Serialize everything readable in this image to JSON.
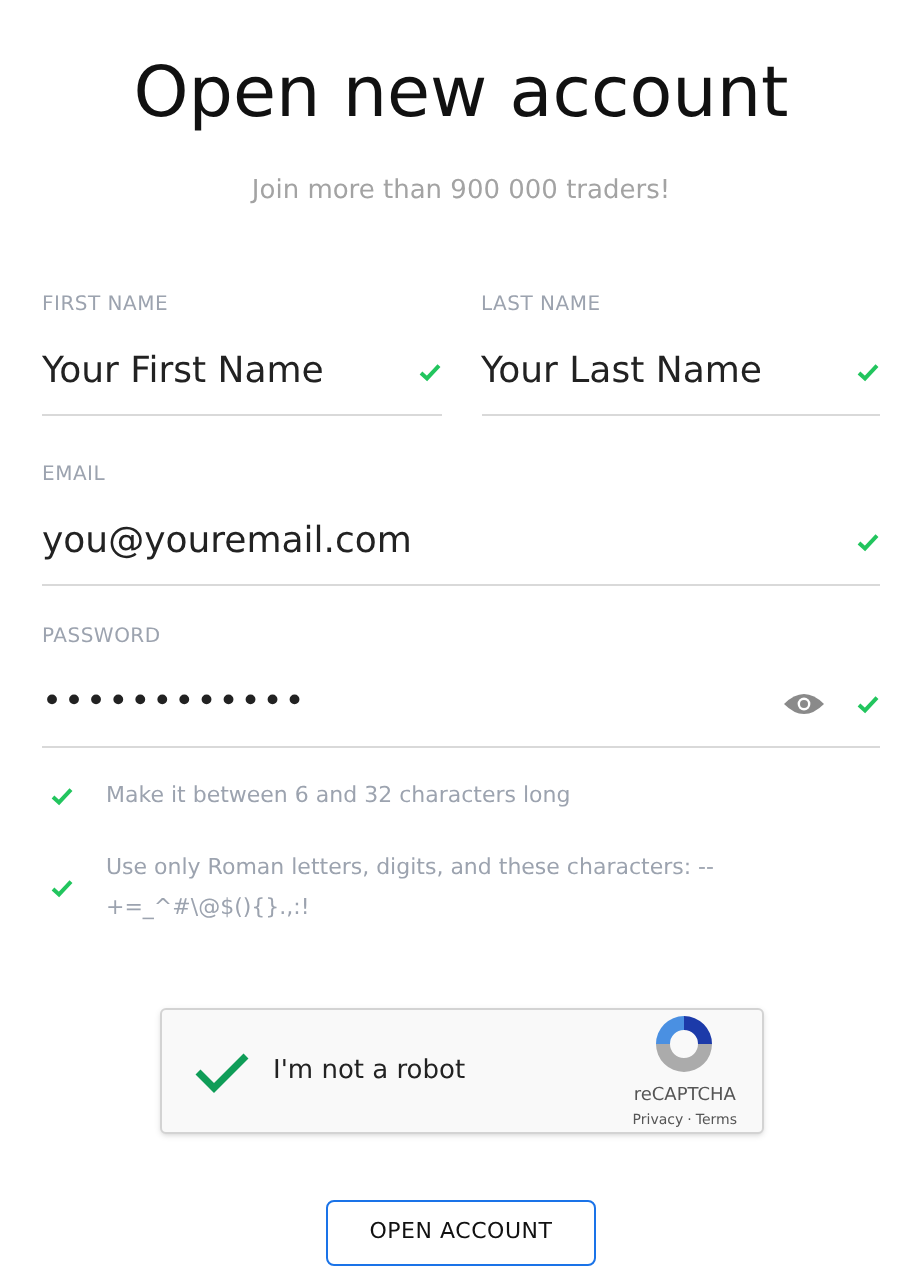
{
  "title": "Open new account",
  "subtitle": "Join more than 900 000 traders!",
  "name_fields": [
    {
      "label": "FIRST NAME",
      "value": "Your First Name",
      "valid": true
    },
    {
      "label": "LAST NAME",
      "value": "Your Last Name",
      "valid": true
    }
  ],
  "fields": [
    {
      "kind": "text",
      "label": "EMAIL",
      "value": "you@youremail.com",
      "valid": true
    },
    {
      "kind": "password",
      "label": "PASSWORD",
      "value": "••••••••••••",
      "valid": true
    }
  ],
  "password_rules": [
    {
      "text": "Make it between 6 and 32 characters long",
      "met": true
    },
    {
      "text": "Use only Roman letters, digits, and these characters: --+=_^#\\@$(){}.,:!",
      "met": true
    }
  ],
  "captcha": {
    "checked": true,
    "label": "I'm not a robot",
    "brand": "reCAPTCHA",
    "privacy": "Privacy",
    "separator": "·",
    "terms": "Terms"
  },
  "submit": "OPEN ACCOUNT"
}
